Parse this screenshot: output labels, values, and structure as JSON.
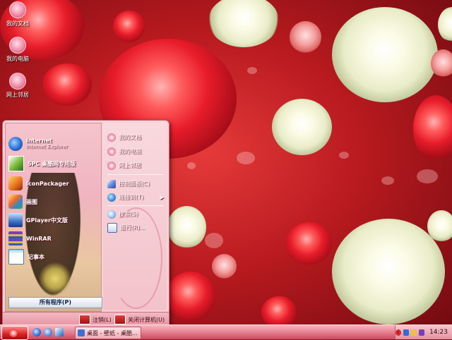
{
  "desktop": {
    "icons": [
      {
        "label": "我的文档",
        "icon": "my-documents-icon"
      },
      {
        "label": "我的电脑",
        "icon": "my-computer-icon"
      },
      {
        "label": "网上邻居",
        "icon": "network-places-icon"
      }
    ]
  },
  "start_menu": {
    "pinned": [
      {
        "title": "Internet",
        "subtitle": "Internet Explorer",
        "icon": "internet-explorer-icon"
      },
      {
        "title": "5PC 桌酷网专用版",
        "icon": "zhuoku-icon"
      }
    ],
    "recent": [
      {
        "title": "IconPackager",
        "icon": "iconpackager-icon"
      },
      {
        "title": "画图",
        "icon": "paint-icon"
      },
      {
        "title": "GPlayer中文版",
        "icon": "gplayer-icon"
      },
      {
        "title": "WinRAR",
        "icon": "winrar-icon"
      },
      {
        "title": "记事本",
        "icon": "notepad-icon"
      }
    ],
    "all_programs": "所有程序(P)",
    "right": {
      "group1": [
        {
          "label": "我的文档",
          "icon": "my-documents-icon"
        },
        {
          "label": "我的电脑",
          "icon": "my-computer-icon"
        },
        {
          "label": "网上邻居",
          "icon": "network-places-icon"
        }
      ],
      "group2": [
        {
          "label": "控制面板(C)",
          "icon": "control-panel-icon"
        },
        {
          "label": "连接到(T)",
          "icon": "connect-icon",
          "arrow": "▶"
        }
      ],
      "group3": [
        {
          "label": "搜索(S)",
          "icon": "search-icon"
        },
        {
          "label": "运行(R)...",
          "icon": "run-icon"
        }
      ]
    },
    "footer": {
      "logoff": "注销(L)",
      "shutdown": "关闭计算机(U)"
    }
  },
  "taskbar": {
    "task_item": "桌面 - 壁纸 - 桌酷...",
    "clock": "14:23",
    "tray_arrow": "‹"
  },
  "colors": {
    "accent": "#d82020",
    "taskbar": "#e47b8c",
    "menu_bg": "#f6d3d8"
  }
}
